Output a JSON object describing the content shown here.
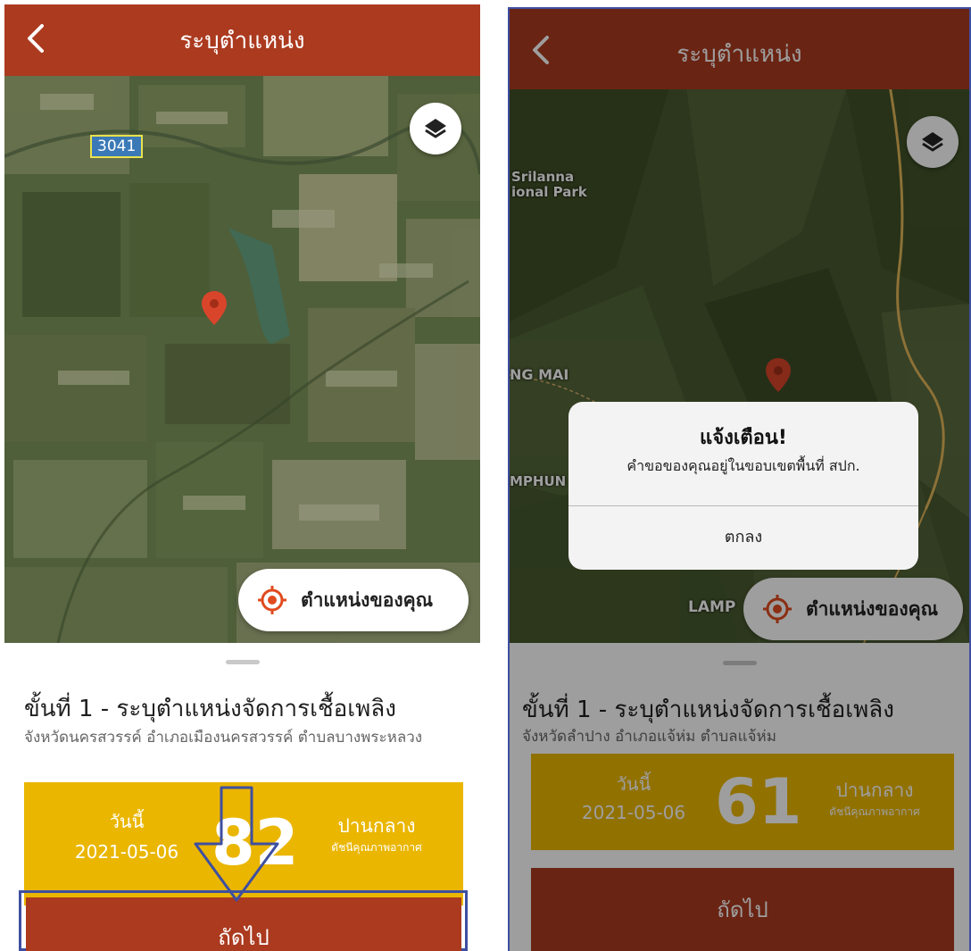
{
  "left": {
    "appbar": {
      "title": "ระบุตำแหน่ง"
    },
    "map": {
      "road_label": "3041"
    },
    "locate_button": {
      "label": "ตำแหน่งของคุณ"
    },
    "sheet": {
      "step_title": "ขั้นที่ 1 - ระบุตำแหน่งจัดการเชื้อเพลิง",
      "address": "จังหวัดนครสวรรค์ อำเภอเมืองนครสวรรค์ ตำบลบางพระหลวง",
      "aqi": {
        "today_label": "วันนี้",
        "date": "2021-05-06",
        "value": "82",
        "level": "ปานกลาง",
        "index_label": "ดัชนีคุณภาพอากาศ"
      },
      "next_label": "ถัดไป"
    }
  },
  "right": {
    "appbar": {
      "title": "ระบุตำแหน่ง"
    },
    "map": {
      "label_park": "Srilanna\nional Park",
      "label_chiangmai": "NG MAI",
      "label_lamphun": "MPHUN",
      "label_lamp": "LAMP"
    },
    "locate_button": {
      "label": "ตำแหน่งของคุณ"
    },
    "sheet": {
      "step_title": "ขั้นที่ 1 - ระบุตำแหน่งจัดการเชื้อเพลิง",
      "address": "จังหวัดลำปาง อำเภอแจ้ห่ม ตำบลแจ้ห่ม",
      "aqi": {
        "today_label": "วันนี้",
        "date": "2021-05-06",
        "value": "61",
        "level": "ปานกลาง",
        "index_label": "ดัชนีคุณภาพอากาศ"
      },
      "next_label": "ถัดไป"
    },
    "alert": {
      "title": "แจ้งเตือน!",
      "message": "คำขอของคุณอยู่ในขอบเขตพื้นที่ สปก.",
      "ok_label": "ตกลง"
    }
  },
  "colors": {
    "appbar": "#ab3a1f",
    "aqi_moderate": "#eab600",
    "pin": "#d9452b",
    "highlight_frame": "#3e4fa0"
  },
  "icons": [
    "back-arrow-icon",
    "layers-icon",
    "location-pin-icon",
    "locate-target-icon",
    "down-arrow-annotation-icon"
  ]
}
